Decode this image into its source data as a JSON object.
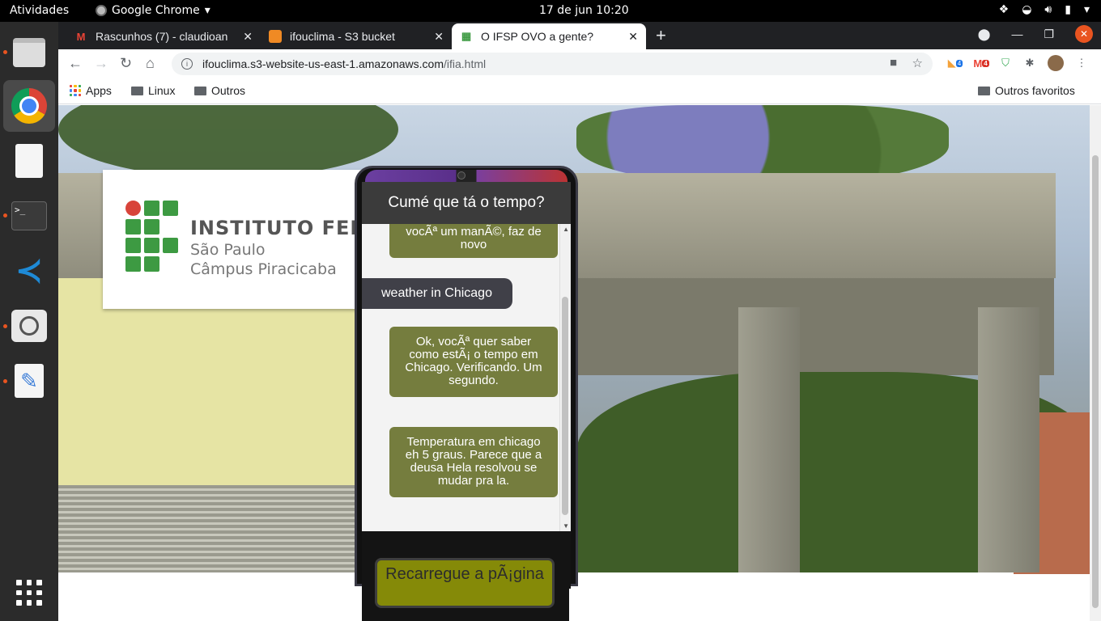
{
  "system": {
    "activities": "Atividades",
    "app_name": "Google Chrome",
    "clock": "17 de jun  10:20"
  },
  "tabs": [
    {
      "title": "Rascunhos (7) - claudioan",
      "favicon": "gmail-icon"
    },
    {
      "title": "ifouclima - S3 bucket",
      "favicon": "aws-icon"
    },
    {
      "title": "O IFSP OVO a gente?",
      "favicon": "ifsp-icon"
    }
  ],
  "address": {
    "host": "ifouclima.s3-website-us-east-1.amazonaws.com",
    "path": "/ifia.html"
  },
  "bookmarks": {
    "apps": "Apps",
    "linux": "Linux",
    "outros": "Outros",
    "outros_favoritos": "Outros favoritos"
  },
  "extensions": {
    "rss_badge": "4",
    "gmail_badge": "4"
  },
  "sign": {
    "title": "INSTITUTO FED",
    "line1": "São Paulo",
    "line2": "Câmpus Piracicaba"
  },
  "chat": {
    "header": "Cumé que tá o tempo?",
    "messages": [
      {
        "from": "bot",
        "text": "vocÃª um manÃ©, faz de novo"
      },
      {
        "from": "user",
        "text": "weather in Chicago"
      },
      {
        "from": "bot",
        "text": "Ok, vocÃª quer saber como estÃ¡ o tempo em Chicago. Verificando. Um segundo."
      },
      {
        "from": "bot",
        "text": "Temperatura em chicago eh 5 graus. Parece que a deusa Hela resolvou se mudar pra la."
      }
    ],
    "reload_button": "Recarregue a pÃ¡gina"
  }
}
